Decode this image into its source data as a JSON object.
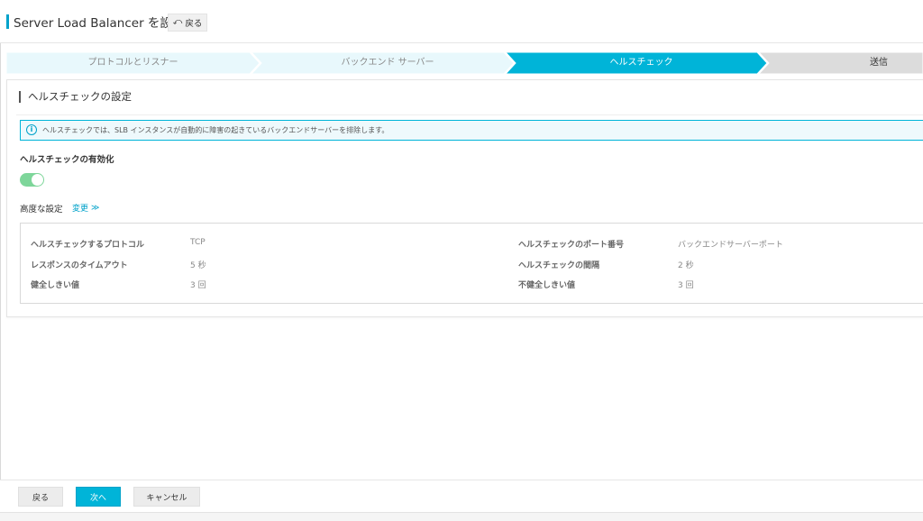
{
  "header": {
    "title": "Server Load Balancer を設定",
    "back_label": "戻る",
    "back_icon": "undo-icon"
  },
  "steps": [
    {
      "label": "プロトコルとリスナー",
      "state": "completed"
    },
    {
      "label": "バックエンド サーバー",
      "state": "completed"
    },
    {
      "label": "ヘルスチェック",
      "state": "active"
    },
    {
      "label": "送信",
      "state": "pending"
    }
  ],
  "colors": {
    "accent": "#00a2ca",
    "step_active": "#00b4d8",
    "step_completed": "#e8f8fc",
    "step_pending": "#dcdcdc",
    "toggle_on": "#7ed69a"
  },
  "card": {
    "title": "ヘルスチェックの設定",
    "info_icon": "info-icon",
    "info_text": "ヘルスチェックでは、SLB インスタンスが自動的に障害の起きているバックエンドサーバーを排除します。",
    "enable_label": "ヘルスチェックの有効化",
    "enable_on": true,
    "advanced_label": "高度な設定",
    "advanced_change": "変更",
    "advanced_icon": "chevron-double-down-icon"
  },
  "settings": {
    "left": [
      {
        "key": "ヘルスチェックするプロトコル",
        "value": "TCP"
      },
      {
        "key": "レスポンスのタイムアウト",
        "value": "5 秒"
      },
      {
        "key": "健全しきい値",
        "value": "3 回"
      }
    ],
    "right": [
      {
        "key": "ヘルスチェックのポート番号",
        "value": "バックエンドサーバーポート"
      },
      {
        "key": "ヘルスチェックの間隔",
        "value": "2 秒"
      },
      {
        "key": "不健全しきい値",
        "value": "3 回"
      }
    ]
  },
  "footer": {
    "back_label": "戻る",
    "next_label": "次へ",
    "cancel_label": "キャンセル"
  }
}
